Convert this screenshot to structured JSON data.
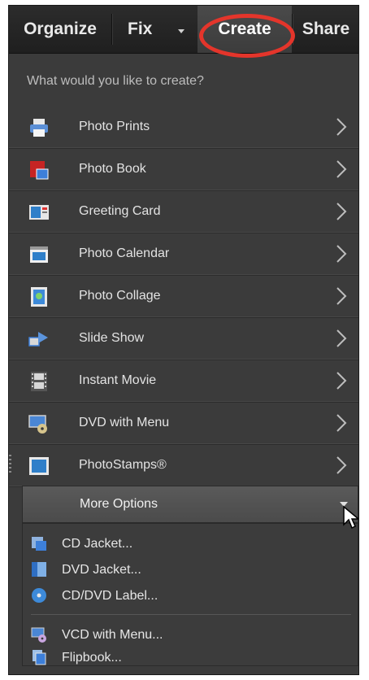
{
  "tabs": [
    {
      "label": "Organize"
    },
    {
      "label": "Fix"
    },
    {
      "label": "Create"
    },
    {
      "label": "Share"
    }
  ],
  "prompt": "What would you like to create?",
  "menu_items": [
    {
      "label": "Photo Prints",
      "icon": "printer-icon"
    },
    {
      "label": "Photo Book",
      "icon": "photo-book-icon"
    },
    {
      "label": "Greeting Card",
      "icon": "greeting-card-icon"
    },
    {
      "label": "Photo Calendar",
      "icon": "calendar-icon"
    },
    {
      "label": "Photo Collage",
      "icon": "collage-icon"
    },
    {
      "label": "Slide Show",
      "icon": "slideshow-icon"
    },
    {
      "label": "Instant Movie",
      "icon": "film-icon"
    },
    {
      "label": "DVD with Menu",
      "icon": "dvd-menu-icon"
    },
    {
      "label": "PhotoStamps®",
      "icon": "stamp-icon"
    }
  ],
  "more_options": {
    "label": "More Options"
  },
  "submenu": [
    {
      "label": "CD Jacket...",
      "icon": "cd-jacket-icon"
    },
    {
      "label": "DVD Jacket...",
      "icon": "dvd-jacket-icon"
    },
    {
      "label": "CD/DVD Label...",
      "icon": "disc-label-icon"
    },
    {
      "label": "VCD with Menu...",
      "icon": "vcd-menu-icon"
    },
    {
      "label": "Flipbook...",
      "icon": "flipbook-icon"
    }
  ],
  "colors": {
    "highlight": "#e4352b",
    "panel": "#3b3b3b",
    "tabbar": "#1f1f1f"
  }
}
